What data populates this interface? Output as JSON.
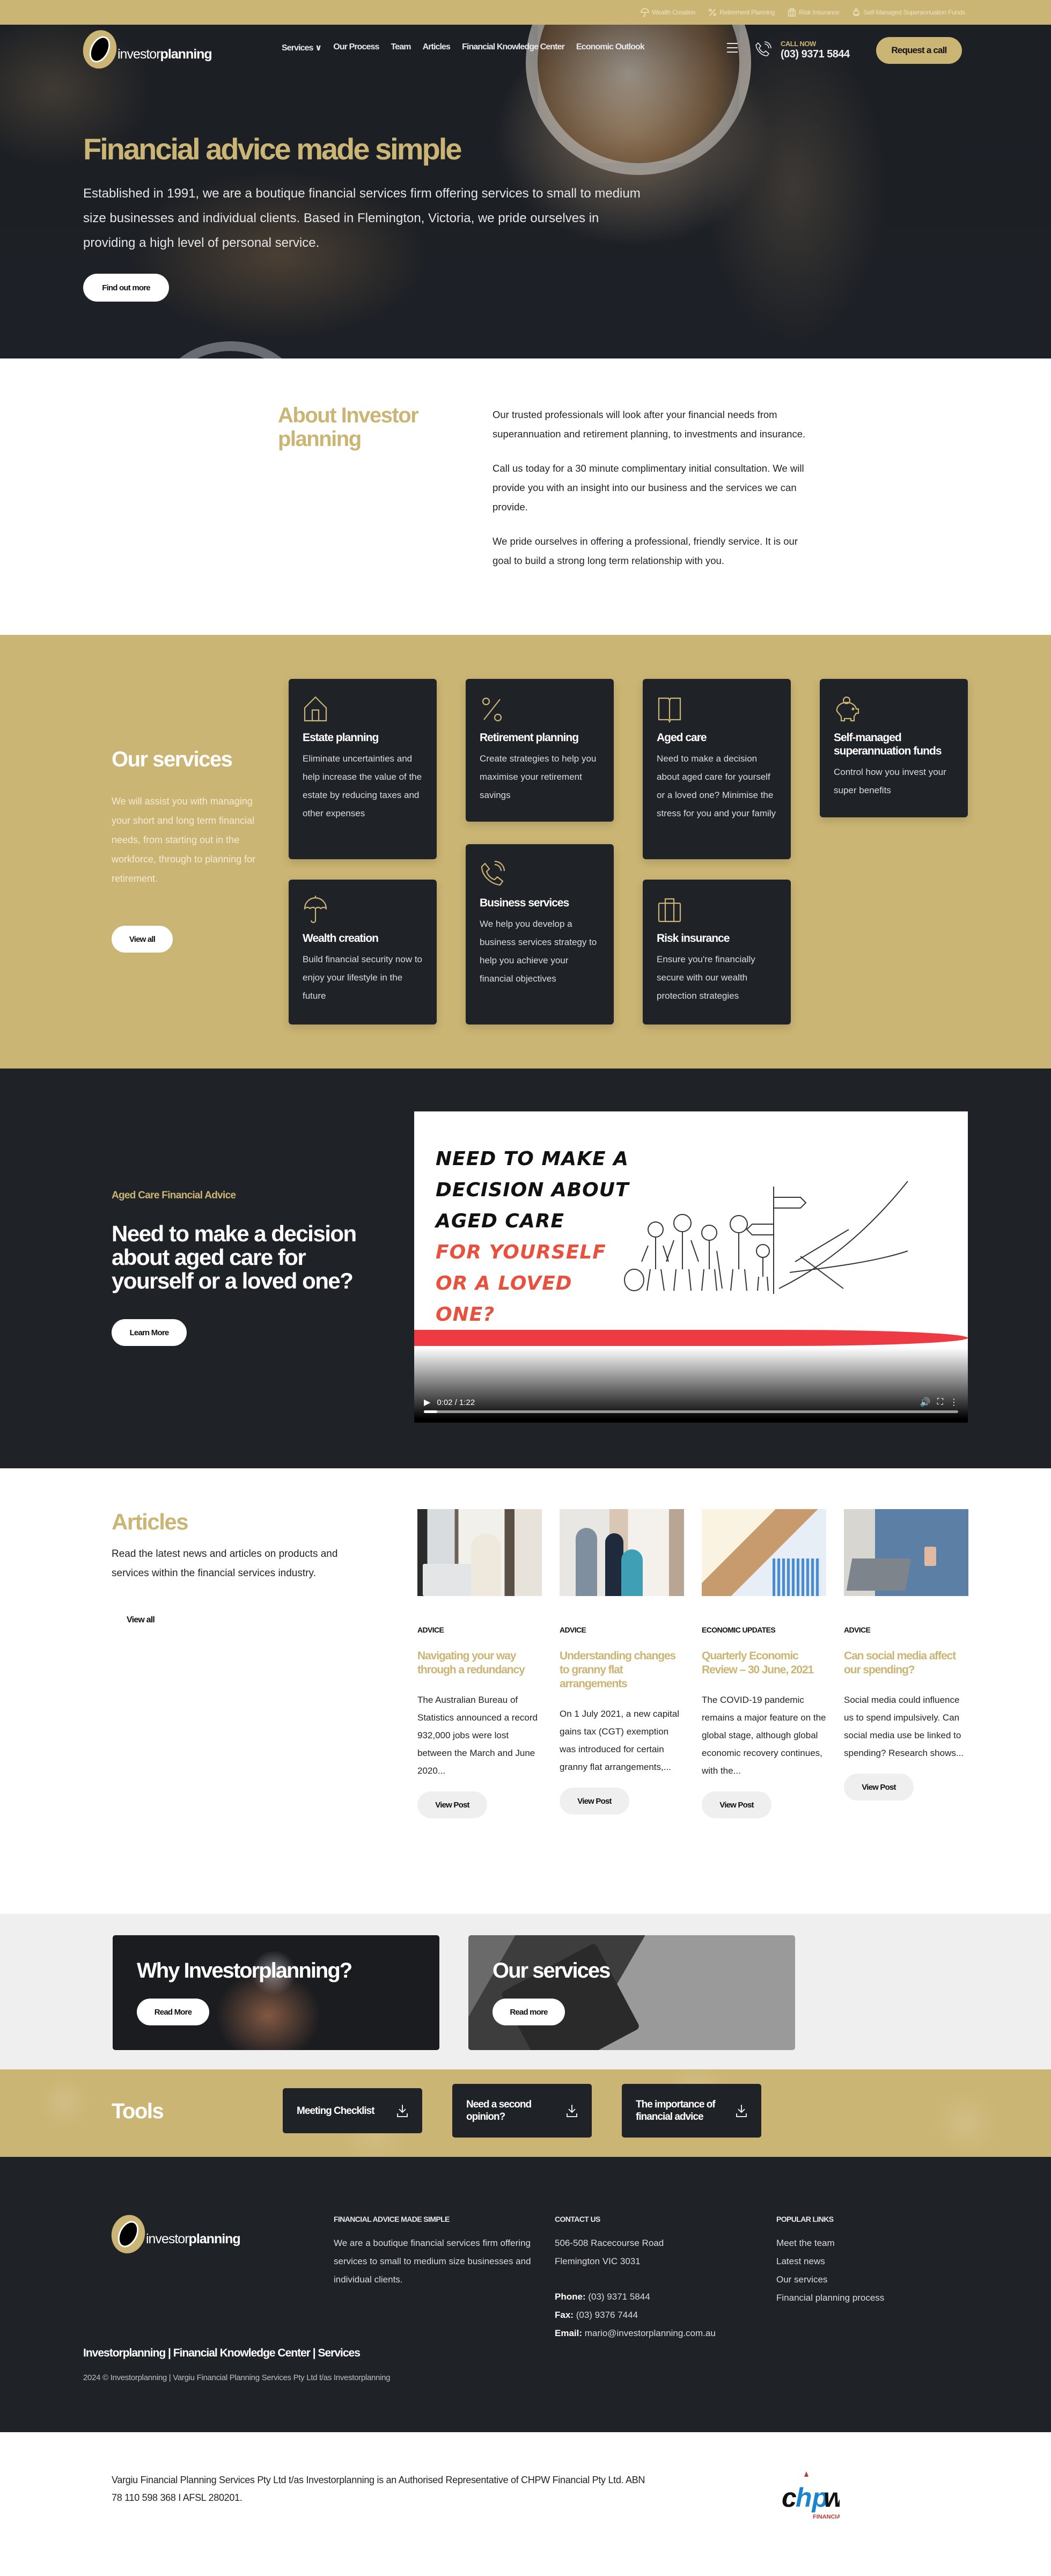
{
  "topbar": {
    "links": [
      {
        "label": "Wealth Creation",
        "icon": "umbrella-icon"
      },
      {
        "label": "Retirement Planning",
        "icon": "percent-icon"
      },
      {
        "label": "Risk Insurance",
        "icon": "briefcase-icon"
      },
      {
        "label": "Self-Managed Superannuation Funds",
        "icon": "piggy-bank-icon"
      }
    ]
  },
  "nav": {
    "logo_light": "investor",
    "logo_bold": "planning",
    "menu": [
      "Services ∨",
      "Our Process",
      "Team",
      "Articles",
      "Financial Knowledge Center",
      "Economic Outlook"
    ],
    "call_now": "CALL NOW",
    "phone": "(03) 9371 5844",
    "request_call": "Request a call"
  },
  "hero": {
    "title": "Financial advice made simple",
    "text": "Established in 1991, we are a boutique financial services firm offering services to small to medium size businesses and individual clients. Based in Flemington, Victoria, we pride ourselves in providing a high level of personal service.",
    "button": "Find out more"
  },
  "about": {
    "title": "About Investor planning",
    "paragraphs": [
      "Our trusted professionals will look after your financial needs from superannuation and retirement planning, to investments and insurance.",
      "Call us today for a 30 minute complimentary initial consultation. We will provide you with an insight into our business and the services we can provide.",
      "We pride ourselves in offering a professional, friendly service. It is our goal to build a strong long term relationship with you."
    ]
  },
  "services": {
    "title": "Our services",
    "text": "We will assist you with managing your short and long term financial needs, from starting out in the workforce, through to planning for retirement.",
    "button": "View all",
    "cards": [
      {
        "title": "Estate planning",
        "text": "Eliminate uncertainties and help increase the value of the estate by reducing taxes and other expenses",
        "icon": "house-icon"
      },
      {
        "title": "Retirement planning",
        "text": "Create strategies to help you maximise your retirement savings",
        "icon": "percent-icon"
      },
      {
        "title": "Aged care",
        "text": "Need to make a decision about aged care for yourself or a loved one? Minimise the stress for you and your family",
        "icon": "book-icon"
      },
      {
        "title": "Self-managed superannuation funds",
        "text": "Control how you invest your super benefits",
        "icon": "piggy-bank-icon"
      },
      {
        "title": "Wealth creation",
        "text": "Build financial security now to enjoy your lifestyle in the future",
        "icon": "umbrella-icon"
      },
      {
        "title": "Business services",
        "text": "We help you develop a business services strategy to help you achieve your financial objectives",
        "icon": "phone-icon"
      },
      {
        "title": "Risk insurance",
        "text": "Ensure you're financially secure with our wealth protection strategies",
        "icon": "briefcase-icon"
      }
    ]
  },
  "aged_care": {
    "eyebrow": "Aged Care Financial Advice",
    "title": "Need to make a decision about aged care for yourself or a loved one?",
    "button": "Learn More",
    "video": {
      "lines_black": [
        "NEED TO MAKE A",
        "DECISION ABOUT",
        "AGED CARE"
      ],
      "lines_red": [
        "FOR YOURSELF",
        "OR A LOVED",
        "ONE?"
      ],
      "time": "0:02 / 1:22",
      "progress": 0.025
    }
  },
  "articles": {
    "title": "Articles",
    "text": "Read the latest news and articles on products and services within the financial services industry.",
    "view_all": "View all",
    "items": [
      {
        "category": "ADVICE",
        "title": "Navigating your way through a redundancy",
        "excerpt": "The Australian Bureau of Statistics announced a record 932,000 jobs were lost between the March and June 2020...",
        "button": "View Post"
      },
      {
        "category": "ADVICE",
        "title": "Understanding changes to granny flat arrangements",
        "excerpt": "On 1 July 2021, a new capital gains tax (CGT) exemption was introduced for certain granny flat arrangements,...",
        "button": "View Post"
      },
      {
        "category": "ECONOMIC UPDATES",
        "title": "Quarterly Economic Review – 30 June, 2021",
        "excerpt": "The COVID-19 pandemic remains a major feature on the global stage, although global economic recovery continues, with the...",
        "button": "View Post"
      },
      {
        "category": "ADVICE",
        "title": "Can social media affect our spending?",
        "excerpt": "Social media could influence us to spend impulsively. Can social media use be linked to spending? Research shows...",
        "button": "View Post"
      }
    ]
  },
  "promo": [
    {
      "title": "Why Investorplanning?",
      "button": "Read More"
    },
    {
      "title": "Our services",
      "button": "Read more"
    }
  ],
  "tools": {
    "title": "Tools",
    "items": [
      "Meeting Checklist",
      "Need a second opinion?",
      "The importance of financial advice"
    ]
  },
  "footer": {
    "about_heading": "FINANCIAL ADVICE MADE SIMPLE",
    "about_text": "We are a boutique financial services firm offering services to small to medium size businesses and individual clients.",
    "contact_heading": "CONTACT US",
    "address_1": "506-508 Racecourse Road",
    "address_2": "Flemington VIC 3031",
    "phone_label": "Phone:",
    "phone": "(03) 9371 5844",
    "fax_label": "Fax:",
    "fax": "(03) 9376 7444",
    "email_label": "Email:",
    "email": "mario@investorplanning.com.au",
    "links_heading": "POPULAR LINKS",
    "links": [
      "Meet the team",
      "Latest news",
      "Our services",
      "Financial planning process"
    ],
    "bottom_links": [
      "Investorplanning",
      "Financial Knowledge Center",
      "Services"
    ],
    "copyright": "2024 © Investorplanning | Vargiu Financial Planning Services Pty Ltd t/as Investorplanning"
  },
  "disclaimer": {
    "text": "Vargiu Financial Planning Services Pty Ltd t/as Investorplanning is an Authorised Representative of CHPW Financial Pty Ltd. ABN 78 110 598 368 I AFSL 280201.",
    "partner_logo_text": "chpw",
    "partner_logo_sub": "FINANCIAL"
  },
  "colors": {
    "gold": "#cbb574",
    "dark": "#1f2227",
    "red": "#ee3a42",
    "chpw_blue": "#1b84d0"
  }
}
